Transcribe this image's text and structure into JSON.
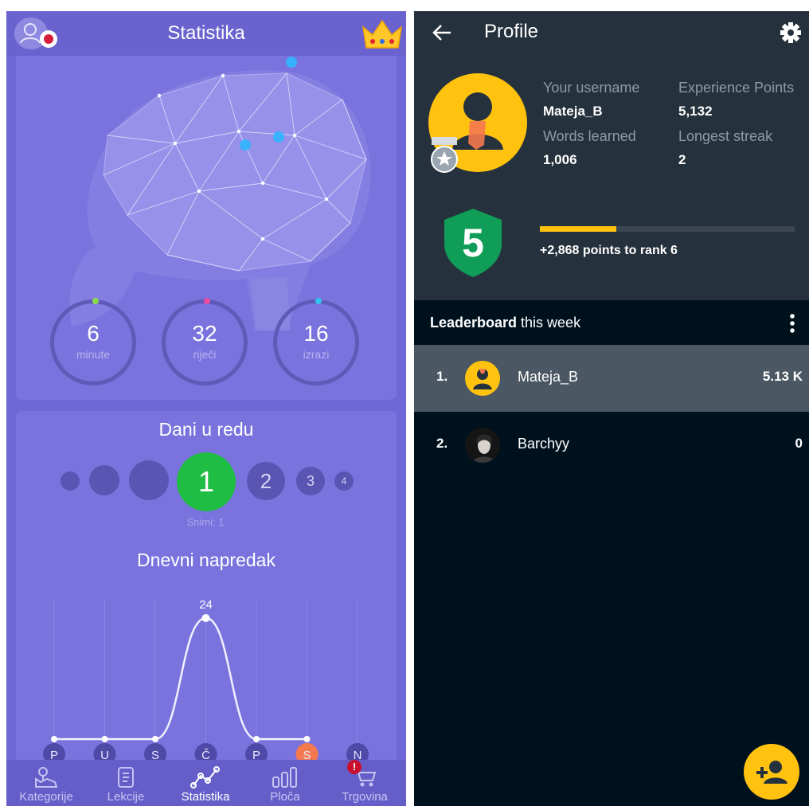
{
  "stats_screen": {
    "title": "Statistika",
    "rings": [
      {
        "value": "6",
        "label": "minute",
        "color": "#8bdc4c"
      },
      {
        "value": "32",
        "label": "riječi",
        "color": "#e94ba0"
      },
      {
        "value": "16",
        "label": "izrazi",
        "color": "#33c3f0"
      }
    ],
    "streak": {
      "heading": "Dani u redu",
      "current": "1",
      "next": [
        "2",
        "3",
        "4"
      ],
      "record": "Snimi: 1"
    },
    "daily": {
      "heading": "Dnevni napredak",
      "peak_label": "24"
    },
    "nav": [
      {
        "label": "Kategorije",
        "icon": "map-icon"
      },
      {
        "label": "Lekcije",
        "icon": "book-icon"
      },
      {
        "label": "Statistika",
        "icon": "chart-icon"
      },
      {
        "label": "Ploča",
        "icon": "bars-icon"
      },
      {
        "label": "Trgovina",
        "icon": "cart-icon"
      }
    ],
    "nav_badge": "!"
  },
  "chart_data": {
    "type": "line",
    "categories": [
      "P",
      "U",
      "S",
      "Č",
      "P",
      "S",
      "N"
    ],
    "values": [
      0,
      0,
      0,
      24,
      0,
      0,
      null
    ],
    "highlight_category_index": 5,
    "data_labels": [
      "24"
    ],
    "title": "Dnevni napredak",
    "xlabel": "",
    "ylabel": "",
    "grid": true
  },
  "profile_screen": {
    "title": "Profile",
    "username_label": "Your username",
    "username": "Mateja_B",
    "xp_label": "Experience Points",
    "xp": "5,132",
    "words_label": "Words learned",
    "words": "1,006",
    "streak_label": "Longest streak",
    "streak": "2",
    "rank": "5",
    "rank_progress": 0.3,
    "points_to_rank": "+2,868 points to rank 6",
    "leaderboard_bold": "Leaderboard",
    "leaderboard_rest": " this week",
    "entries": [
      {
        "rank": "1.",
        "name": "Mateja_B",
        "score": "5.13 K"
      },
      {
        "rank": "2.",
        "name": "Barchyy",
        "score": "0"
      }
    ]
  },
  "colors": {
    "left_bg": "#6e67d6",
    "streak_green": "#20bd45",
    "highlight_orange": "#f5794f",
    "accent_yellow": "#ffc20e",
    "rank_green": "#0f9d58",
    "dark_bg": "#00111e"
  }
}
